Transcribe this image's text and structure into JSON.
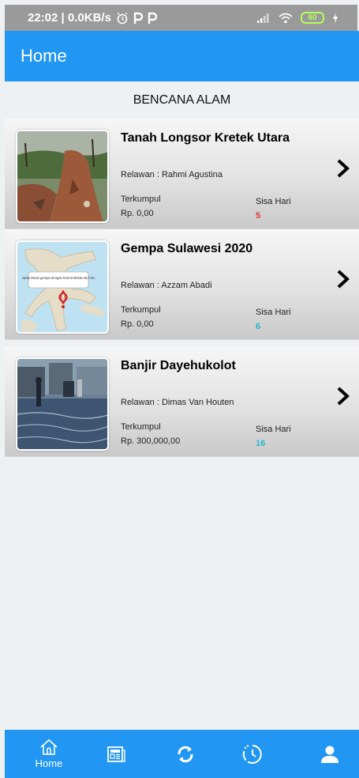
{
  "status_bar": {
    "time_speed": "22:02 | 0.0KB/s",
    "battery": "60",
    "icons": [
      "alarm-icon",
      "p-app-icon",
      "p-app-icon",
      "signal-icon",
      "wifi-icon",
      "battery-icon",
      "charging-icon"
    ]
  },
  "app_bar": {
    "title": "Home"
  },
  "section": {
    "title": "BENCANA ALAM"
  },
  "cards": [
    {
      "title": "Tanah Longsor Kretek Utara",
      "volunteer": "Relawan : Rahmi Agustina",
      "collected_label": "Terkumpul",
      "collected_value": "Rp. 0,00",
      "days_label": "Sisa Hari",
      "days_value": "5",
      "days_color": "#e53935",
      "image": "landslide-photo"
    },
    {
      "title": "Gempa Sulawesi 2020",
      "volunteer": "Relawan : Azzam Abadi",
      "collected_label": "Terkumpul",
      "collected_value": "Rp. 0,00",
      "days_label": "Sisa Hari",
      "days_value": "6",
      "days_color": "#26b6d0",
      "image": "sulawesi-map",
      "map_tooltip": "Jarak lokasi gempa dengan kota terdekat 29,0 km"
    },
    {
      "title": "Banjir Dayehukolot",
      "volunteer": "Relawan : Dimas Van Houten",
      "collected_label": "Terkumpul",
      "collected_value": "Rp. 300,000,00",
      "days_label": "Sisa Hari",
      "days_value": "16",
      "days_color": "#26b6d0",
      "image": "flood-photo"
    }
  ],
  "bottom_nav": {
    "items": [
      {
        "label": "Home",
        "icon": "home-icon",
        "active": true
      },
      {
        "label": "",
        "icon": "news-icon"
      },
      {
        "label": "",
        "icon": "sync-icon"
      },
      {
        "label": "",
        "icon": "history-icon"
      },
      {
        "label": "",
        "icon": "profile-icon"
      }
    ]
  },
  "colors": {
    "primary": "#2196f3",
    "urgent": "#e53935",
    "info": "#26b6d0"
  }
}
